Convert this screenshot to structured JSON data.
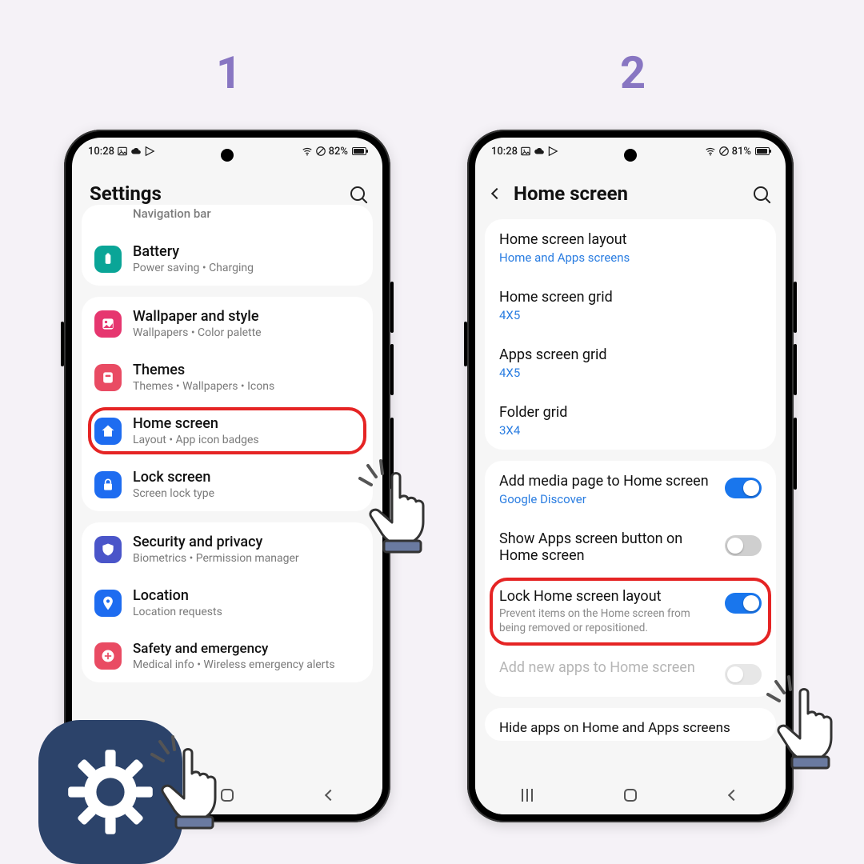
{
  "steps": {
    "one": "1",
    "two": "2"
  },
  "status1": {
    "time": "10:28",
    "battery": "82%"
  },
  "status2": {
    "time": "10:28",
    "battery": "81%"
  },
  "screen1": {
    "title": "Settings",
    "nav_hint": "Navigation bar",
    "items": {
      "battery": {
        "title": "Battery",
        "sub": "Power saving  •  Charging"
      },
      "wallpaper": {
        "title": "Wallpaper and style",
        "sub": "Wallpapers  •  Color palette"
      },
      "themes": {
        "title": "Themes",
        "sub": "Themes  •  Wallpapers  •  Icons"
      },
      "home": {
        "title": "Home screen",
        "sub": "Layout  •  App icon badges"
      },
      "lock": {
        "title": "Lock screen",
        "sub": "Screen lock type"
      },
      "security": {
        "title": "Security and privacy",
        "sub": "Biometrics  •  Permission manager"
      },
      "location": {
        "title": "Location",
        "sub": "Location requests"
      },
      "safety": {
        "title": "Safety and emergency",
        "sub": "Medical info  •  Wireless emergency alerts"
      }
    }
  },
  "screen2": {
    "title": "Home screen",
    "rows": {
      "layout": {
        "title": "Home screen layout",
        "value": "Home and Apps screens"
      },
      "hgrid": {
        "title": "Home screen grid",
        "value": "4X5"
      },
      "agrid": {
        "title": "Apps screen grid",
        "value": "4X5"
      },
      "fgrid": {
        "title": "Folder grid",
        "value": "3X4"
      },
      "media": {
        "title": "Add media page to Home screen",
        "value": "Google Discover",
        "on": true
      },
      "appsbtn": {
        "title": "Show Apps screen button on Home screen",
        "on": false
      },
      "locklayout": {
        "title": "Lock Home screen layout",
        "desc": "Prevent items on the Home screen from being removed or repositioned.",
        "on": true
      },
      "addnew": {
        "title": "Add new apps to Home screen",
        "on": false
      },
      "hide": {
        "title": "Hide apps on Home and Apps screens"
      }
    }
  }
}
